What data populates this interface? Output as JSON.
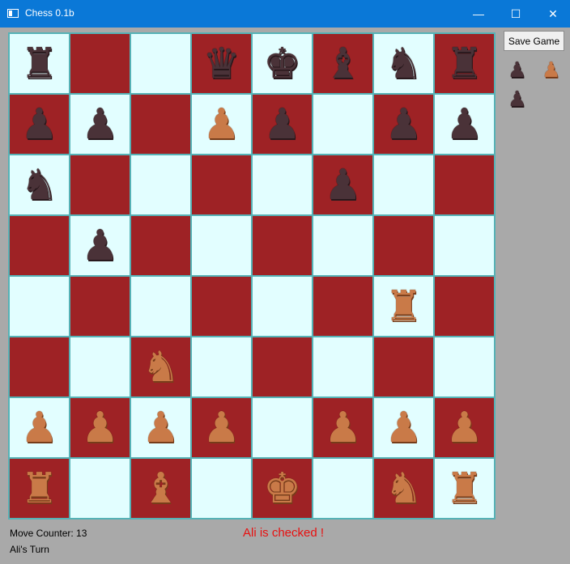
{
  "window": {
    "title": "Chess 0.1b",
    "minimize_glyph": "—",
    "maximize_glyph": "☐",
    "close_glyph": "✕"
  },
  "colors": {
    "light_square": "#e2feff",
    "dark_square": "#9e2225",
    "black_piece": "#4a3238",
    "white_piece": "#c97a48",
    "status_text": "#e81010"
  },
  "board": {
    "rows": [
      [
        "bR",
        "",
        "",
        "bQ",
        "bK",
        "bB",
        "bN",
        "bR"
      ],
      [
        "bP",
        "bP",
        "",
        "wP",
        "bP",
        "",
        "bP",
        "bP"
      ],
      [
        "bN",
        "",
        "",
        "",
        "",
        "bP",
        "",
        ""
      ],
      [
        "",
        "bP",
        "",
        "",
        "",
        "",
        "",
        ""
      ],
      [
        "",
        "",
        "",
        "",
        "",
        "",
        "wR",
        ""
      ],
      [
        "",
        "",
        "wN",
        "",
        "",
        "",
        "",
        ""
      ],
      [
        "wP",
        "wP",
        "wP",
        "wP",
        "",
        "wP",
        "wP",
        "wP"
      ],
      [
        "wR",
        "",
        "wB",
        "",
        "wK",
        "",
        "wN",
        "wR"
      ]
    ]
  },
  "toolbar": {
    "save_label": "Save Game"
  },
  "captured": [
    "bP",
    "wP",
    "bP"
  ],
  "status": {
    "move_counter": "Move Counter: 13",
    "turn": "Ali's Turn",
    "message": "Ali is checked !"
  }
}
